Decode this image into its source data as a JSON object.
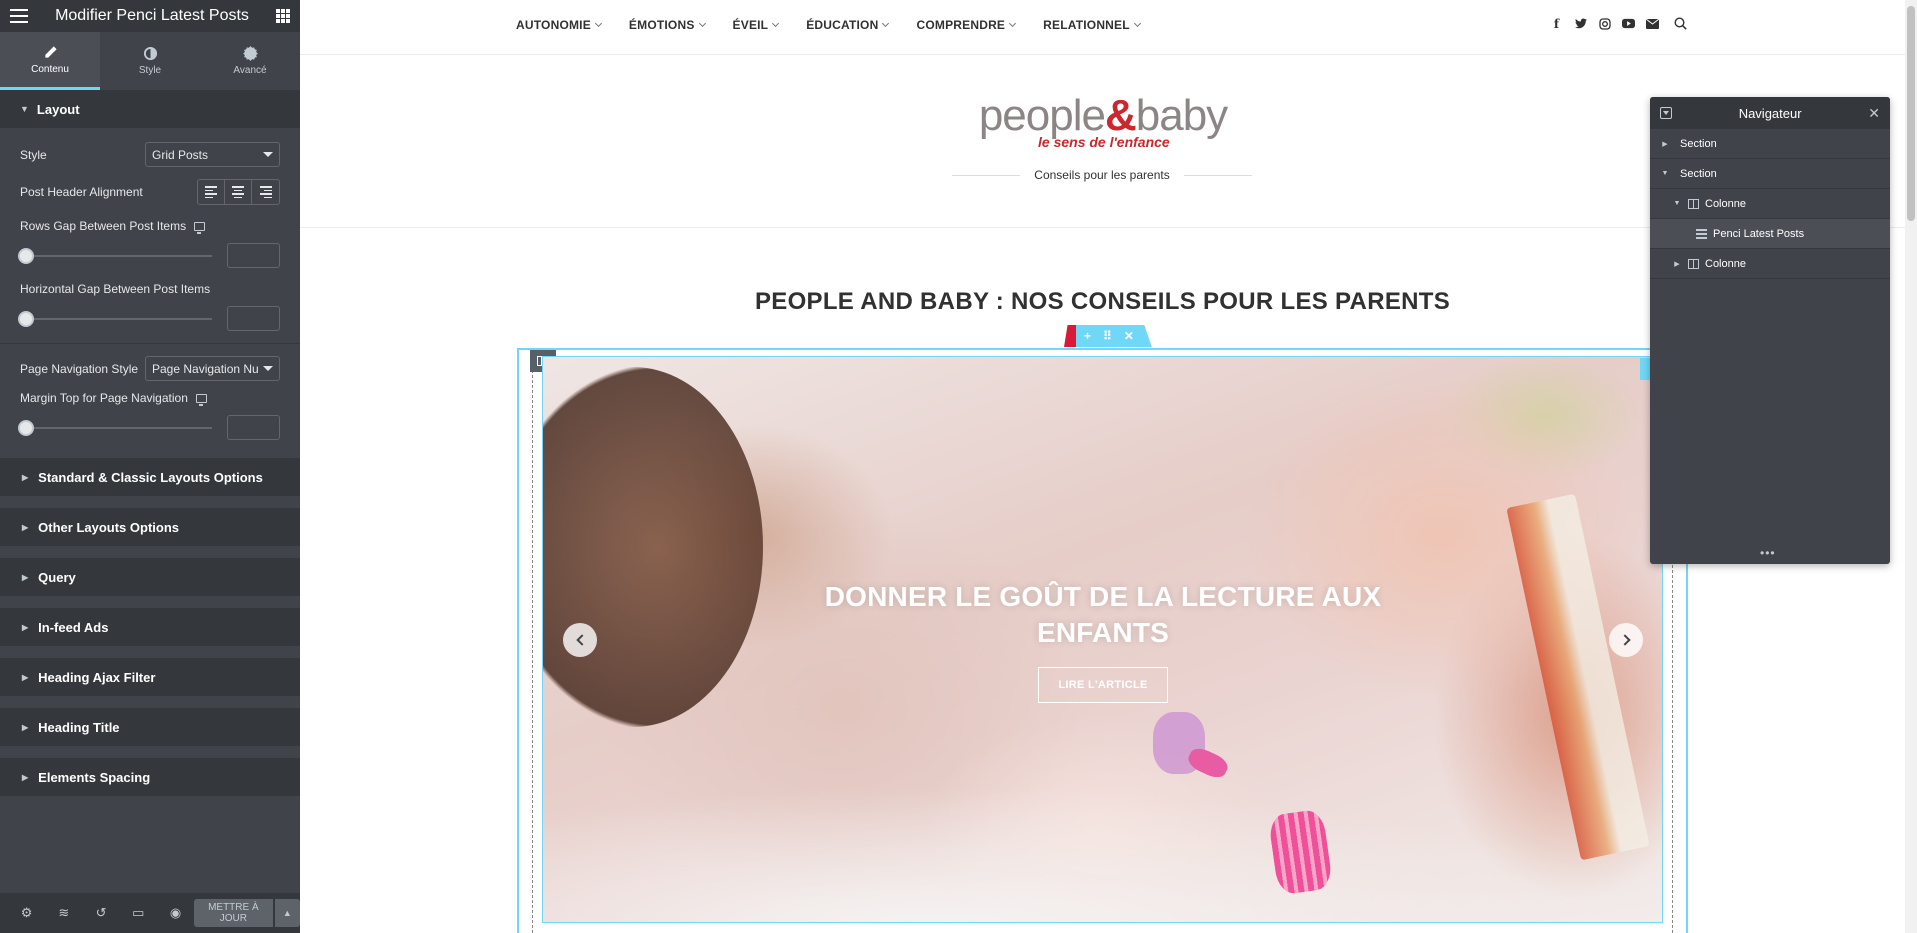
{
  "panel": {
    "title": "Modifier Penci Latest Posts",
    "tabs": [
      {
        "label": "Contenu",
        "icon": "pencil-icon",
        "active": true
      },
      {
        "label": "Style",
        "icon": "contrast-icon",
        "active": false
      },
      {
        "label": "Avancé",
        "icon": "gear-icon",
        "active": false
      }
    ],
    "layout": {
      "heading": "Layout",
      "style_label": "Style",
      "style_value": "Grid Posts",
      "header_align_label": "Post Header Alignment",
      "rows_gap_label": "Rows Gap Between Post Items",
      "horizontal_gap_label": "Horizontal Gap Between Post Items",
      "page_nav_style_label": "Page Navigation Style",
      "page_nav_style_value": "Page Navigation Numbers",
      "margin_top_label": "Margin Top for Page Navigation"
    },
    "sections": [
      "Standard & Classic Layouts Options",
      "Other Layouts Options",
      "Query",
      "In-feed Ads",
      "Heading Ajax Filter",
      "Heading Title",
      "Elements Spacing"
    ],
    "footer": {
      "update_label": "METTRE À JOUR"
    }
  },
  "site": {
    "menu": [
      "AUTONOMIE",
      "ÉMOTIONS",
      "ÉVEIL",
      "ÉDUCATION",
      "COMPRENDRE",
      "RELATIONNEL"
    ],
    "social": [
      "facebook-icon",
      "twitter-icon",
      "instagram-icon",
      "youtube-icon",
      "mail-icon",
      "search-icon"
    ],
    "logo_main_1": "people",
    "logo_amp": "&",
    "logo_main_2": "baby",
    "logo_tag": "le sens de l'enfance",
    "tagline": "Conseils pour les parents",
    "page_heading": "PEOPLE AND BABY : NOS CONSEILS POUR LES PARENTS",
    "slide": {
      "title": "DONNER LE GOÛT DE LA LECTURE AUX ENFANTS",
      "button": "LIRE L'ARTICLE"
    }
  },
  "navigator": {
    "title": "Navigateur",
    "items": [
      {
        "label": "Section",
        "level": 0,
        "expanded": false
      },
      {
        "label": "Section",
        "level": 0,
        "expanded": true
      },
      {
        "label": "Colonne",
        "level": 1,
        "expanded": true
      },
      {
        "label": "Penci Latest Posts",
        "level": 2,
        "selected": true
      },
      {
        "label": "Colonne",
        "level": 1,
        "expanded": false
      }
    ]
  },
  "colors": {
    "panel_bg": "#404349",
    "panel_dark": "#34383c",
    "accent": "#71d7f7",
    "brand_red": "#c8282e"
  }
}
